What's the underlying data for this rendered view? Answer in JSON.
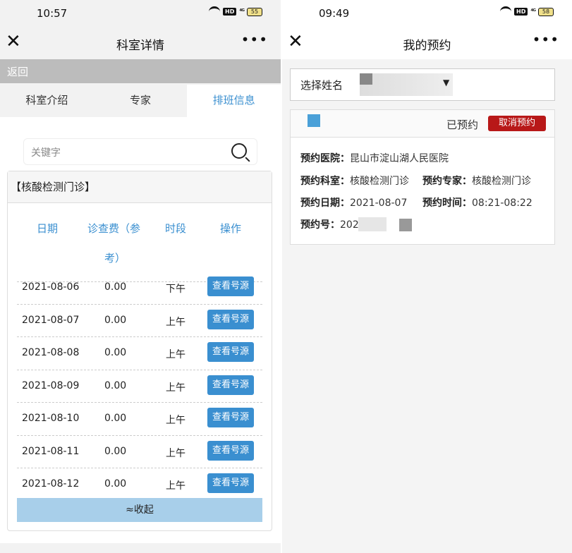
{
  "left": {
    "status_time": "10:57",
    "battery": "55",
    "title": "科室详情",
    "close": "✕",
    "more": "•••",
    "back": "返回",
    "tabs": [
      "科室介绍",
      "专家",
      "排班信息"
    ],
    "search_placeholder": "关键字",
    "dept_title": "【核酸检测门诊】",
    "headers": [
      "日期",
      "诊查费（参",
      "考）",
      "时段",
      "操作"
    ],
    "rows": [
      {
        "date": "2021-08-06",
        "fee": "0.00",
        "period": "下午",
        "action": "查看号源"
      },
      {
        "date": "2021-08-07",
        "fee": "0.00",
        "period": "上午",
        "action": "查看号源"
      },
      {
        "date": "2021-08-08",
        "fee": "0.00",
        "period": "上午",
        "action": "查看号源"
      },
      {
        "date": "2021-08-09",
        "fee": "0.00",
        "period": "上午",
        "action": "查看号源"
      },
      {
        "date": "2021-08-10",
        "fee": "0.00",
        "period": "上午",
        "action": "查看号源"
      },
      {
        "date": "2021-08-11",
        "fee": "0.00",
        "period": "上午",
        "action": "查看号源"
      },
      {
        "date": "2021-08-12",
        "fee": "0.00",
        "period": "上午",
        "action": "查看号源"
      }
    ],
    "collapse": "≈收起"
  },
  "right": {
    "status_time": "09:49",
    "battery": "58",
    "title": "我的预约",
    "close": "✕",
    "more": "•••",
    "select_label": "选择姓名",
    "select_arrow": "▼",
    "status": "已预约",
    "cancel": "取消预约",
    "hospital_label": "预约医院：",
    "hospital": "昆山市淀山湖人民医院",
    "dept_label": "预约科室：",
    "dept": "核酸检测门诊",
    "expert_label": "预约专家：",
    "expert": "核酸检测门诊",
    "date_label": "预约日期：",
    "date": "2021-08-07",
    "time_label": "预约时间：",
    "time": "08:21-08:22",
    "no_label": "预约号：",
    "no": "2021"
  },
  "status_icons": {
    "hd": "HD",
    "signal": "⁴ᴳ"
  },
  "colors": {
    "accent": "#3a8fd0",
    "cancel": "#b81818",
    "collapse": "#a8cfea"
  }
}
